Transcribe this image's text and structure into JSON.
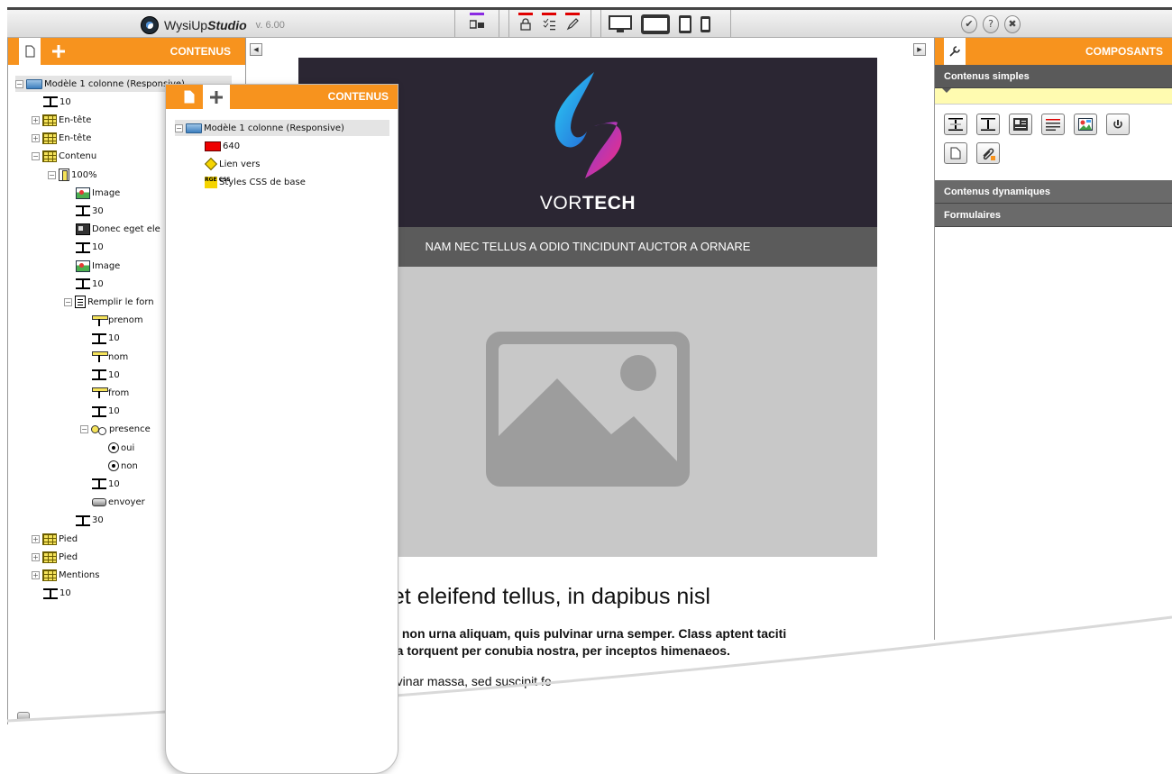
{
  "app": {
    "name_prefix": "WysiUp",
    "name_suffix": "Studio",
    "version": "v. 6.00"
  },
  "toolbar": {
    "marks": {
      "purple": "#8a2be2",
      "red": "#e00000"
    }
  },
  "left_panel": {
    "title": "CONTENUS",
    "tree": [
      {
        "label": "Modèle 1 colonne (Responsive)",
        "icon": "folder-icon",
        "level": 0,
        "exp": "−"
      },
      {
        "label": "10",
        "icon": "spacer-icon",
        "level": 1,
        "exp": ""
      },
      {
        "label": "En-tête",
        "icon": "grid-icon",
        "level": 1,
        "exp": "+"
      },
      {
        "label": "En-tête",
        "icon": "grid-icon",
        "level": 1,
        "exp": "+"
      },
      {
        "label": "Contenu",
        "icon": "grid-icon",
        "level": 1,
        "exp": "−"
      },
      {
        "label": "100%",
        "icon": "column-icon",
        "level": 2,
        "exp": "−"
      },
      {
        "label": "Image",
        "icon": "image-icon",
        "level": 3,
        "exp": ""
      },
      {
        "label": "30",
        "icon": "spacer-icon",
        "level": 3,
        "exp": ""
      },
      {
        "label": "Donec eget ele",
        "icon": "text-image-icon",
        "level": 3,
        "exp": ""
      },
      {
        "label": "10",
        "icon": "spacer-icon",
        "level": 3,
        "exp": ""
      },
      {
        "label": "Image",
        "icon": "image-icon",
        "level": 3,
        "exp": ""
      },
      {
        "label": "10",
        "icon": "spacer-icon",
        "level": 3,
        "exp": ""
      },
      {
        "label": "Remplir le forn",
        "icon": "form-icon",
        "level": 3,
        "exp": "−"
      },
      {
        "label": "prenom",
        "icon": "input-icon",
        "level": 4,
        "exp": ""
      },
      {
        "label": "10",
        "icon": "spacer-icon",
        "level": 4,
        "exp": ""
      },
      {
        "label": "nom",
        "icon": "input-icon",
        "level": 4,
        "exp": ""
      },
      {
        "label": "10",
        "icon": "spacer-icon",
        "level": 4,
        "exp": ""
      },
      {
        "label": "from",
        "icon": "input-icon",
        "level": 4,
        "exp": ""
      },
      {
        "label": "10",
        "icon": "spacer-icon",
        "level": 4,
        "exp": ""
      },
      {
        "label": "presence",
        "icon": "radio-group-icon",
        "level": 4,
        "exp": "−"
      },
      {
        "label": "oui",
        "icon": "radio-icon",
        "level": 5,
        "exp": ""
      },
      {
        "label": "non",
        "icon": "radio-icon",
        "level": 5,
        "exp": ""
      },
      {
        "label": "10",
        "icon": "spacer-icon",
        "level": 4,
        "exp": ""
      },
      {
        "label": "envoyer",
        "icon": "button-icon",
        "level": 4,
        "exp": ""
      },
      {
        "label": "30",
        "icon": "spacer-icon",
        "level": 3,
        "exp": ""
      },
      {
        "label": "Pied",
        "icon": "grid-icon",
        "level": 1,
        "exp": "+"
      },
      {
        "label": "Pied",
        "icon": "grid-icon",
        "level": 1,
        "exp": "+"
      },
      {
        "label": "Mentions",
        "icon": "grid-icon",
        "level": 1,
        "exp": "+"
      },
      {
        "label": "10",
        "icon": "spacer-icon",
        "level": 1,
        "exp": ""
      }
    ]
  },
  "float_panel": {
    "title": "CONTENUS",
    "tree": [
      {
        "label": "Modèle 1 colonne (Responsive)",
        "icon": "folder-icon",
        "level": 0,
        "exp": "−"
      },
      {
        "label": "640",
        "icon": "red-block-icon",
        "level": 1,
        "exp": ""
      },
      {
        "label": "Lien vers",
        "icon": "link-icon",
        "level": 1,
        "exp": ""
      },
      {
        "label": "Styles CSS de base",
        "icon": "css-icon",
        "level": 1,
        "exp": ""
      }
    ]
  },
  "email": {
    "brand_light": "VOR",
    "brand_bold": "TECH",
    "banner": "NAM NEC TELLUS A ODIO TINCIDUNT AUCTOR A ORNARE",
    "title": "get eleifend tellus, in dapibus nisl",
    "bold_text": "dui non urna aliquam, quis pulvinar urna semper. Class aptent taciti\ntora torquent per conubia nostra, per inceptos himenaeos.",
    "normal_text": "pulvinar massa, sed suscipit fe",
    "hero_color": "#2b2633",
    "banner_color": "#5b5b5b",
    "image_color": "#c8c8c8"
  },
  "right_panel": {
    "title": "COMPOSANTS",
    "sections": {
      "simple": "Contenus simples",
      "dynamic": "Contenus dynamiques",
      "forms": "Formulaires"
    },
    "components": [
      "spacer-double-icon",
      "spacer-icon",
      "text-image-icon",
      "text-icon",
      "image-icon",
      "link-icon",
      "page-icon",
      "attachment-icon"
    ]
  },
  "colors": {
    "accent": "#f7931e",
    "dark": "#444444"
  }
}
